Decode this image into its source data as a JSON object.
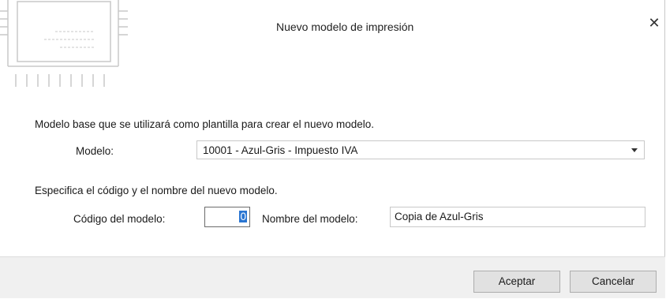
{
  "dialog": {
    "title": "Nuevo modelo de impresión",
    "close_symbol": "✕",
    "icons": {
      "header_decoration": "document-template-icon",
      "close": "close-icon",
      "dropdown": "chevron-down-icon"
    }
  },
  "base_section": {
    "intro_text": "Modelo base que se utilizará como plantilla para crear el nuevo modelo.",
    "modelo_label": "Modelo:",
    "modelo_value": "10001 - Azul-Gris - Impuesto IVA"
  },
  "new_section": {
    "intro_text": "Especifica el código y el nombre del nuevo modelo.",
    "codigo_label": "Código del modelo:",
    "codigo_value": "0",
    "nombre_label": "Nombre del modelo:",
    "nombre_value": "Copia de Azul-Gris"
  },
  "buttons": {
    "ok_label": "Aceptar",
    "cancel_label": "Cancelar"
  },
  "colors": {
    "footer_bg": "#f0f0f0",
    "selection": "#2a76d2",
    "decoration_lines": "#c8c8c8"
  }
}
